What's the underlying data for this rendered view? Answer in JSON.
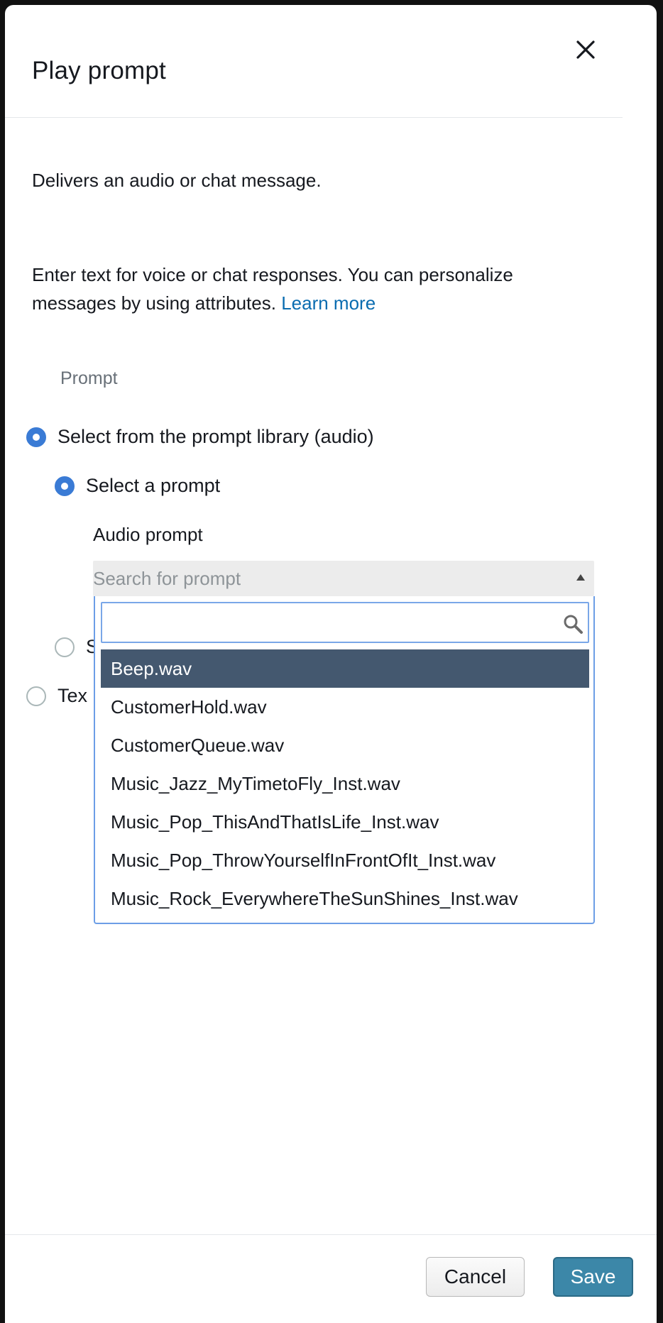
{
  "dialog": {
    "title": "Play prompt",
    "description": "Delivers an audio or chat message.",
    "help_text": "Enter text for voice or chat responses. You can personalize messages by using attributes.",
    "learn_more_label": "Learn more",
    "close_icon": "close-icon"
  },
  "prompt_section": {
    "label": "Prompt",
    "options": [
      {
        "label": "Select from the prompt library (audio)",
        "checked": true
      },
      {
        "label": "Select a prompt",
        "checked": true
      },
      {
        "label": "S",
        "checked": false
      },
      {
        "label": "Tex",
        "checked": false
      }
    ],
    "audio_prompt": {
      "label": "Audio prompt",
      "placeholder": "Search for prompt",
      "search_value": "",
      "search_icon": "search-icon",
      "items": [
        "Beep.wav",
        "CustomerHold.wav",
        "CustomerQueue.wav",
        "Music_Jazz_MyTimetoFly_Inst.wav",
        "Music_Pop_ThisAndThatIsLife_Inst.wav",
        "Music_Pop_ThrowYourselfInFrontOfIt_Inst.wav",
        "Music_Rock_EverywhereTheSunShines_Inst.wav"
      ],
      "highlighted_index": 0
    }
  },
  "footer": {
    "cancel_label": "Cancel",
    "save_label": "Save"
  },
  "colors": {
    "link": "#0a6cb0",
    "radio_selected": "#3a7bd5",
    "highlight_row": "#44586f",
    "save_button": "#3c87a8"
  }
}
